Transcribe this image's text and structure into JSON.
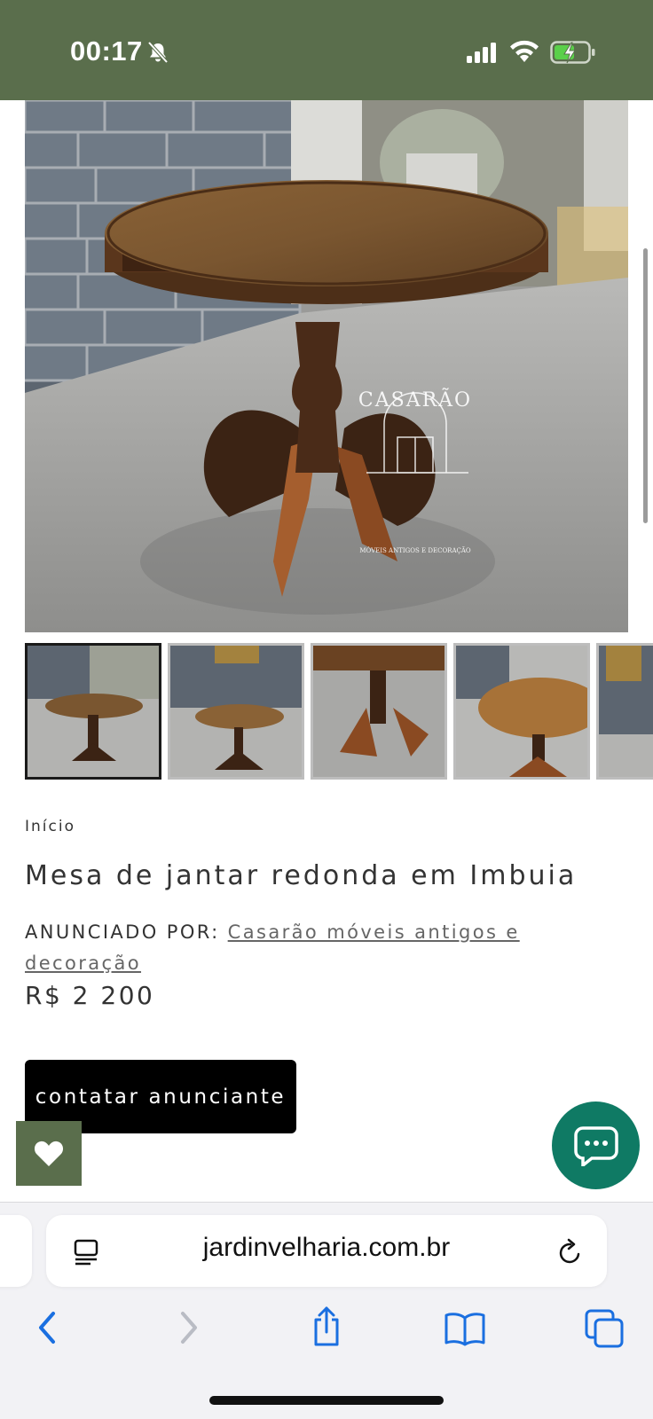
{
  "status_bar": {
    "time": "00:17",
    "background_color": "#5a6e4c",
    "icons": [
      "bell-slash-icon",
      "cellular-signal-icon",
      "wifi-icon",
      "battery-charging-icon"
    ]
  },
  "product": {
    "main_image_watermark": "CASARÃO",
    "main_image_watermark_tagline": "MÓVEIS ANTIGOS E DECORAÇÃO",
    "thumbnails_count_visible": 5,
    "breadcrumb": "Início",
    "title": "Mesa de jantar redonda em Imbuia",
    "advertiser_label": "ANUNCIADO POR:",
    "advertiser_name": "Casarão móveis antigos e decoração",
    "price": "R$ 2 200",
    "contact_button": "contatar anunciante"
  },
  "colors": {
    "brand_green": "#5a6e4c",
    "chat_fab": "#0f7a64",
    "button_black": "#000000"
  },
  "floating": {
    "favorite_icon": "heart-icon",
    "chat_icon": "chat-bubble-icon"
  },
  "browser": {
    "url": "jardinvelharia.com.br",
    "icons": [
      "reader-icon",
      "reload-icon",
      "back-icon",
      "forward-icon",
      "share-icon",
      "bookmarks-icon",
      "tabs-icon"
    ]
  }
}
